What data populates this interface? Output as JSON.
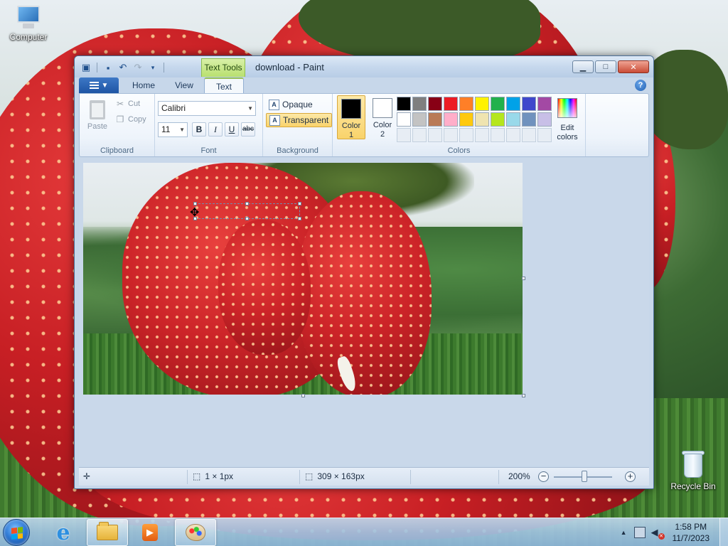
{
  "desktop": {
    "icons": [
      {
        "label": "Computer"
      },
      {
        "label": "Recycle Bin"
      }
    ]
  },
  "window": {
    "title": "download - Paint",
    "context_tab": "Text Tools",
    "tabs": [
      "Home",
      "View",
      "Text"
    ],
    "active_tab": "Text"
  },
  "ribbon": {
    "clipboard": {
      "paste": "Paste",
      "cut": "Cut",
      "copy": "Copy",
      "label": "Clipboard"
    },
    "font": {
      "family": "Calibri",
      "size": "11",
      "bold": "B",
      "italic": "I",
      "underline": "U",
      "strike": "abc",
      "label": "Font"
    },
    "background": {
      "opaque": "Opaque",
      "transparent": "Transparent",
      "label": "Background",
      "selected": "Transparent"
    },
    "colors": {
      "color1_label": "Color",
      "color1_num": "1",
      "color2_label": "Color",
      "color2_num": "2",
      "color1": "#000000",
      "color2": "#ffffff",
      "edit_label_1": "Edit",
      "edit_label_2": "colors",
      "label": "Colors",
      "palette": [
        "#000000",
        "#7f7f7f",
        "#880015",
        "#ed1c24",
        "#ff7f27",
        "#fff200",
        "#22b14c",
        "#00a2e8",
        "#3f48cc",
        "#a349a4",
        "#ffffff",
        "#c3c3c3",
        "#b97a57",
        "#ffaec9",
        "#ffc90e",
        "#efe4b0",
        "#b5e61d",
        "#99d9ea",
        "#7092be",
        "#c8bfe7",
        "",
        "",
        "",
        "",
        "",
        "",
        "",
        "",
        "",
        ""
      ]
    }
  },
  "statusbar": {
    "selection_size": "1 × 1px",
    "image_size": "309 × 163px",
    "zoom": "200%",
    "zoom_fraction": 0.52
  },
  "taskbar": {
    "time": "1:58 PM",
    "date": "11/7/2023"
  }
}
